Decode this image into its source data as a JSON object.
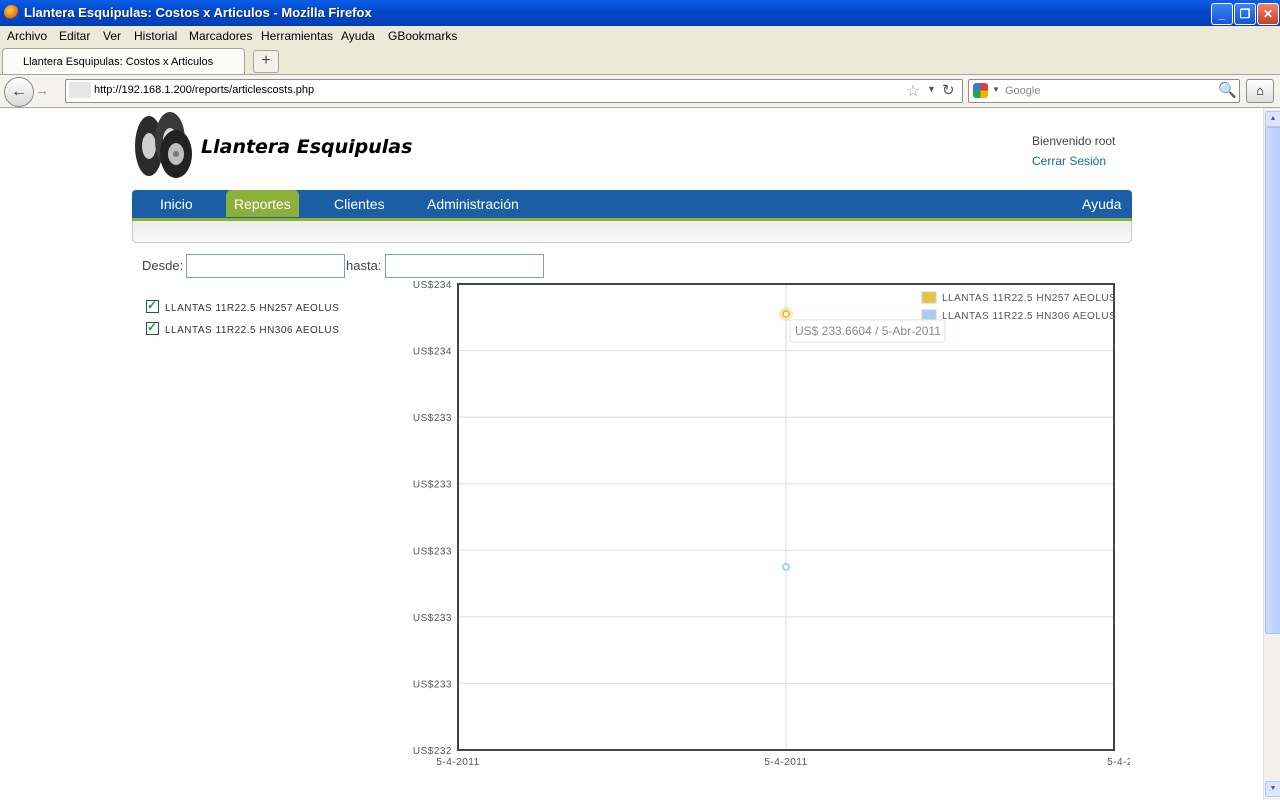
{
  "window": {
    "title": "Llantera Esquipulas: Costos x Articulos - Mozilla Firefox"
  },
  "menu": [
    "Archivo",
    "Editar",
    "Ver",
    "Historial",
    "Marcadores",
    "Herramientas",
    "Ayuda",
    "GBookmarks"
  ],
  "tab": {
    "label": "Llantera Esquipulas: Costos x Articulos",
    "new_tab": "+"
  },
  "nav": {
    "url": "http://192.168.1.200/reports/articlescosts.php",
    "search_placeholder": "Google"
  },
  "site": {
    "title": "Llantera Esquipulas",
    "welcome": "Bienvenido root",
    "logout": "Cerrar Sesión",
    "nav": [
      "Inicio",
      "Reportes",
      "Clientes",
      "Administración"
    ],
    "active_nav": "Reportes",
    "help": "Ayuda"
  },
  "filters": {
    "desde_label": "Desde:",
    "hasta_label": "hasta:",
    "desde_value": "",
    "hasta_value": ""
  },
  "articles": [
    {
      "label": "LLANTAS 11R22.5 HN257 AEOLUS",
      "checked": true
    },
    {
      "label": "LLANTAS 11R22.5 HN306 AEOLUS",
      "checked": true
    }
  ],
  "chart_data": {
    "type": "line",
    "y_tick_labels": [
      "US$234",
      "US$234",
      "US$233",
      "US$233",
      "US$233",
      "US$233",
      "US$233",
      "US$232"
    ],
    "x_tick_labels": [
      "5-4-2011",
      "5-4-2011",
      "5-4-2"
    ],
    "series": [
      {
        "name": "LLANTAS 11R22.5 HN257 AEOLUS",
        "color": "#e8c23c",
        "x": [
          "5-4-2011"
        ],
        "values": [
          233.6604
        ]
      },
      {
        "name": "LLANTAS 11R22.5 HN306 AEOLUS",
        "color": "#a8cdf0",
        "x": [
          "5-4-2011"
        ],
        "values": [
          232.9
        ]
      }
    ],
    "ylim": [
      232.35,
      233.75
    ],
    "tooltip": "US$ 233.6604 / 5-Abr-2011",
    "legend": "top-right",
    "grid": true
  }
}
